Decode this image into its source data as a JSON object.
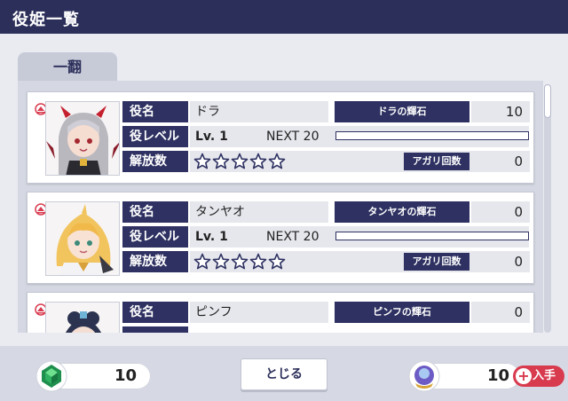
{
  "header": {
    "title": "役姫一覧"
  },
  "tabs": [
    {
      "label": "一翻",
      "active": true
    }
  ],
  "field_labels": {
    "name": "役名",
    "level": "役レベル",
    "release": "解放数",
    "agari": "アガリ回数"
  },
  "cards": [
    {
      "name": "ドラ",
      "stone_label": "ドラの輝石",
      "stone_count": "10",
      "level": "Lv. 1",
      "next": "NEXT 20",
      "exp_progress": 0,
      "stars_filled": 0,
      "stars_total": 5,
      "agari_count": "0"
    },
    {
      "name": "タンヤオ",
      "stone_label": "タンヤオの輝石",
      "stone_count": "0",
      "level": "Lv. 1",
      "next": "NEXT 20",
      "exp_progress": 0,
      "stars_filled": 0,
      "stars_total": 5,
      "agari_count": "0"
    },
    {
      "name": "ピンフ",
      "stone_label": "ピンフの輝石",
      "stone_count": "0"
    }
  ],
  "footer": {
    "green_gem_count": "10",
    "close_label": "とじる",
    "purple_gem_count": "10",
    "get_label": "入手",
    "get_icon": "+"
  },
  "colors": {
    "navy": "#2e3161",
    "header": "#2c2f5a",
    "accent_red": "#d83a4e"
  }
}
